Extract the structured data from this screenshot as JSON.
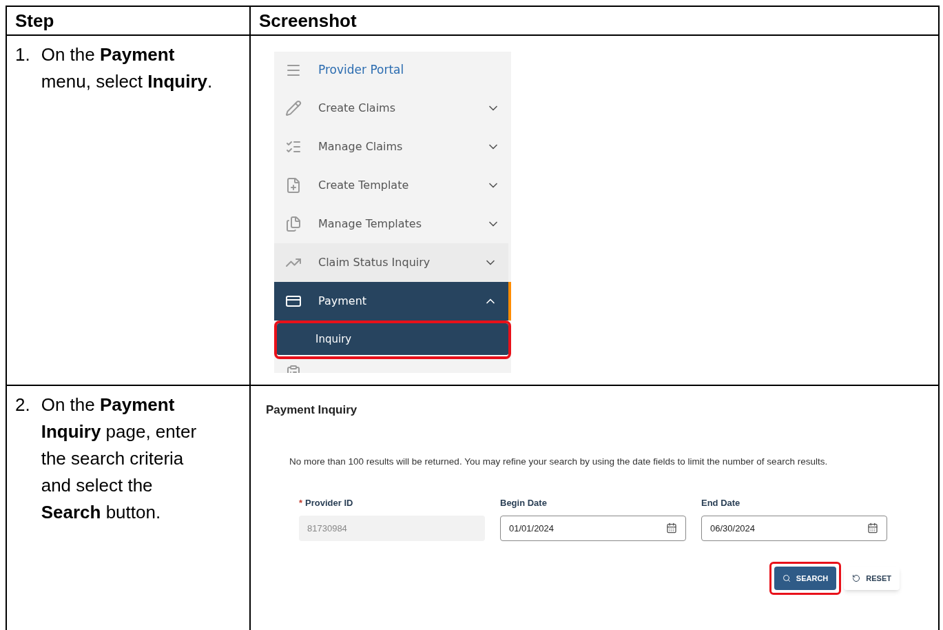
{
  "table": {
    "columns": [
      "Step",
      "Screenshot"
    ],
    "rows": [
      {
        "number": "1.",
        "step": "On the **Payment** menu, select **Inquiry**.",
        "kind": "menu",
        "menu": {
          "title": "Provider Portal",
          "items": [
            {
              "label": "Create Claims",
              "expanded": false,
              "selected": false,
              "hovered": false
            },
            {
              "label": "Manage Claims",
              "expanded": false,
              "selected": false,
              "hovered": false
            },
            {
              "label": "Create Template",
              "expanded": false,
              "selected": false,
              "hovered": false
            },
            {
              "label": "Manage Templates",
              "expanded": false,
              "selected": false,
              "hovered": false
            },
            {
              "label": "Claim Status Inquiry",
              "expanded": false,
              "selected": false,
              "hovered": true
            },
            {
              "label": "Payment",
              "expanded": true,
              "selected": true,
              "hovered": false,
              "children": [
                {
                  "label": "Inquiry",
                  "selected": true,
                  "highlighted": true
                }
              ]
            }
          ]
        }
      },
      {
        "number": "2.",
        "step": "On the **Payment Inquiry** page, enter the search criteria and select the **Search** button.",
        "kind": "form",
        "form": {
          "title": "Payment Inquiry",
          "note": "No more than 100 results will be returned. You may refine your search by using the date fields to limit the number of search results.",
          "fields": [
            {
              "label": "Provider ID",
              "required_mark": "*",
              "value": "81730984",
              "disabled": true,
              "kind": "text"
            },
            {
              "label": "Begin Date",
              "value": "01/01/2024",
              "disabled": false,
              "kind": "date"
            },
            {
              "label": "End Date",
              "value": "06/30/2024",
              "disabled": false,
              "kind": "date"
            }
          ],
          "buttons": [
            {
              "label": "SEARCH",
              "kind": "primary",
              "highlighted": true
            },
            {
              "label": "RESET",
              "kind": "secondary",
              "highlighted": false
            }
          ]
        }
      }
    ]
  }
}
